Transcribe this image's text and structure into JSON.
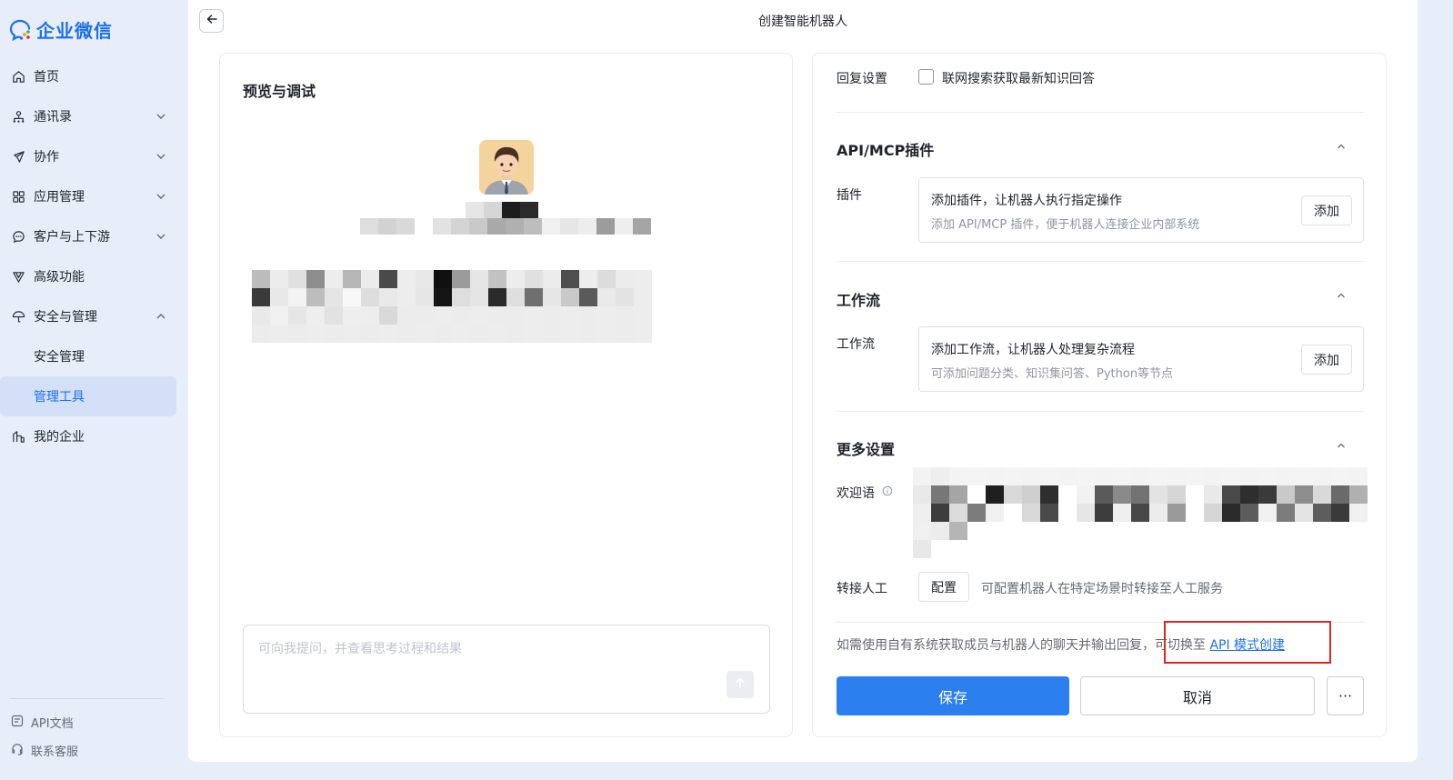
{
  "app": {
    "name": "企业微信",
    "brand_color": "#1a6ff5"
  },
  "sidebar": {
    "items": [
      {
        "label": "首页",
        "icon": "home-icon",
        "expandable": false
      },
      {
        "label": "通讯录",
        "icon": "contacts-icon",
        "expandable": true,
        "expanded": false
      },
      {
        "label": "协作",
        "icon": "collaboration-icon",
        "expandable": true,
        "expanded": false
      },
      {
        "label": "应用管理",
        "icon": "apps-icon",
        "expandable": true,
        "expanded": false
      },
      {
        "label": "客户与上下游",
        "icon": "chat-bubble-icon",
        "expandable": true,
        "expanded": false
      },
      {
        "label": "高级功能",
        "icon": "filter-icon",
        "expandable": false
      },
      {
        "label": "安全与管理",
        "icon": "umbrella-icon",
        "expandable": true,
        "expanded": true
      },
      {
        "label": "安全管理",
        "sub": true
      },
      {
        "label": "管理工具",
        "sub": true,
        "active": true
      },
      {
        "label": "我的企业",
        "icon": "building-icon",
        "expandable": false
      }
    ],
    "footer": {
      "api_docs": "API文档",
      "support": "联系客服"
    }
  },
  "header": {
    "title": "创建智能机器人"
  },
  "preview": {
    "title": "预览与调试",
    "input_placeholder": "可向我提问，并查看思考过程和结果"
  },
  "settings": {
    "reply": {
      "label": "回复设置",
      "checkbox_label": "联网搜索获取最新知识回答",
      "checked": false
    },
    "plugins": {
      "section_title": "API/MCP插件",
      "row_label": "插件",
      "title": "添加插件，让机器人执行指定操作",
      "desc": "添加 API/MCP 插件，便于机器人连接企业内部系统",
      "add_label": "添加"
    },
    "workflow": {
      "section_title": "工作流",
      "row_label": "工作流",
      "title": "添加工作流，让机器人处理复杂流程",
      "desc": "可添加问题分类、知识集问答、Python等节点",
      "add_label": "添加"
    },
    "more": {
      "section_title": "更多设置",
      "welcome_label": "欢迎语",
      "handoff_label": "转接人工",
      "config_label": "配置",
      "handoff_desc": "可配置机器人在特定场景时转接至人工服务"
    },
    "api_hint": {
      "prefix": "如需使用自有系统获取成员与机器人的聊天并输出回复，",
      "switch_text": "可切换至",
      "link": "API 模式创建"
    },
    "actions": {
      "save": "保存",
      "cancel": "取消",
      "more": "···"
    }
  },
  "colors": {
    "primary": "#2b7fee",
    "highlight_box": "#e3261d",
    "sidebar_bg": "#e8eef9",
    "sidebar_active_bg": "#d3e0f8"
  }
}
